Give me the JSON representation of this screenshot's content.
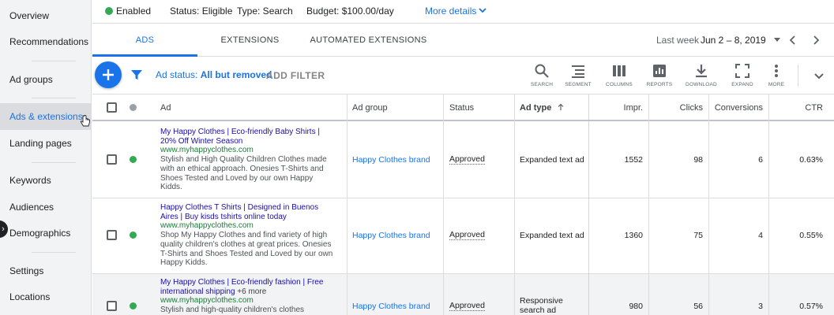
{
  "sidebar": {
    "items": [
      {
        "label": "Overview"
      },
      {
        "label": "Recommendations"
      },
      {
        "label": "Ad groups"
      },
      {
        "label": "Ads & extensions"
      },
      {
        "label": "Landing pages"
      },
      {
        "label": "Keywords"
      },
      {
        "label": "Audiences"
      },
      {
        "label": "Demographics"
      },
      {
        "label": "Settings"
      },
      {
        "label": "Locations"
      }
    ],
    "active": "Ads & extensions"
  },
  "status_bar": {
    "enabled": "Enabled",
    "status": "Status: Eligible",
    "type": "Type: Search",
    "budget": "Budget: $100.00/day",
    "more_details": "More details"
  },
  "tabs": [
    {
      "label": "ADS",
      "active": true
    },
    {
      "label": "EXTENSIONS",
      "active": false
    },
    {
      "label": "AUTOMATED EXTENSIONS",
      "active": false
    }
  ],
  "date_range": {
    "label": "Last week",
    "value": "Jun 2 – 8, 2019"
  },
  "toolbar": {
    "add_icon": "plus-icon",
    "filter_prefix": "Ad status: ",
    "filter_value": "All but removed",
    "add_filter": "ADD FILTER",
    "tools": [
      {
        "label": "SEARCH",
        "icon": "search-icon"
      },
      {
        "label": "SEGMENT",
        "icon": "segment-icon"
      },
      {
        "label": "COLUMNS",
        "icon": "columns-icon"
      },
      {
        "label": "REPORTS",
        "icon": "reports-icon"
      },
      {
        "label": "DOWNLOAD",
        "icon": "download-icon"
      },
      {
        "label": "EXPAND",
        "icon": "expand-icon"
      },
      {
        "label": "MORE",
        "icon": "more-vert-icon"
      }
    ]
  },
  "table": {
    "columns": [
      "Ad",
      "Ad group",
      "Status",
      "Ad type",
      "Impr.",
      "Clicks",
      "Conversions",
      "CTR"
    ],
    "sorted_column": "Ad type",
    "rows": [
      {
        "title": "My Happy Clothes | Eco-friendly Baby Shirts | 20% Off Winter Season",
        "url": "www.myhappyclothes.com",
        "description": "Stylish and High Quality Children Clothes made with an ethical approach. Onesies T-Shirts and Shoes Tested and Loved by our own Happy Kidds.",
        "ad_group": "Happy Clothes brand",
        "status": "Approved",
        "ad_type": "Expanded text ad",
        "impr": "1552",
        "clicks": "98",
        "conversions": "6",
        "ctr": "0.63%"
      },
      {
        "title": "Happy Clothes T Shirts | Designed in Buenos Aires | Buy kisds tshirts online today",
        "url": "www.myhappyclothes.com",
        "description": "Shop My Happy Clothes and find variety of high quality children's clothes at great prices. Onesies T-Shirts and Shoes Tested and Loved by our own Happy Kidds.",
        "ad_group": "Happy Clothes brand",
        "status": "Approved",
        "ad_type": "Expanded text ad",
        "impr": "1360",
        "clicks": "75",
        "conversions": "4",
        "ctr": "0.55%"
      },
      {
        "title": "My Happy Clothes | Eco-friendly fashion | Free international shipping",
        "more": "+6 more",
        "url": "www.myhappyclothes.com",
        "description": "Stylish and high-quality children's clothes",
        "ad_group": "Happy Clothes brand",
        "status": "Approved",
        "ad_type": "Responsive search ad",
        "impr": "980",
        "clicks": "56",
        "conversions": "3",
        "ctr": "0.57%"
      }
    ]
  },
  "colors": {
    "accent": "#1a73e8",
    "enabled": "#34a853",
    "ad_title": "#1a0dab",
    "ad_url": "#188038"
  }
}
